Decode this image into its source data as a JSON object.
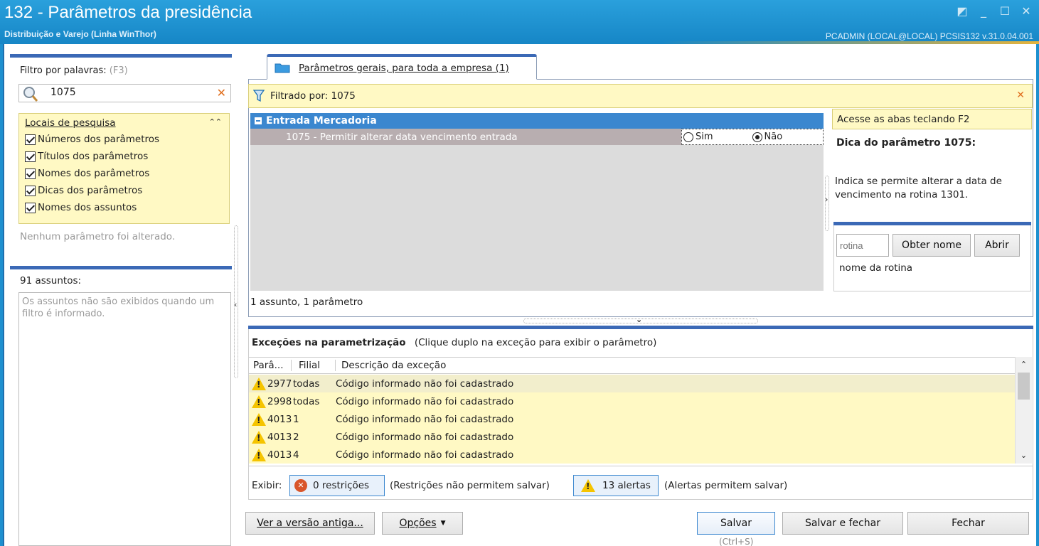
{
  "window": {
    "title": "132 - Parâmetros da presidência",
    "subtitle": "Distribuição e Varejo (Linha WinThor)",
    "user_info": "PCADMIN (LOCAL@LOCAL)   PCSIS132  v.31.0.04.001"
  },
  "left": {
    "filter_label": "Filtro por palavras:",
    "filter_shortcut": "(F3)",
    "filter_value": "1075",
    "locais_title": "Locais de pesquisa",
    "checkboxes": [
      "Números dos parâmetros",
      "Títulos dos parâmetros",
      "Nomes dos parâmetros",
      "Dicas dos parâmetros",
      "Nomes dos assuntos"
    ],
    "no_change_text": "Nenhum parâmetro foi alterado.",
    "assuntos_label": "91 assuntos:",
    "assuntos_info": "Os assuntos não são exibidos quando um filtro é informado."
  },
  "tab": {
    "label": "Parâmetros gerais, para toda a empresa  (1)"
  },
  "filterbar": {
    "text": "Filtrado por: 1075"
  },
  "grid": {
    "group": "Entrada Mercadoria",
    "row_label": "1075 - Permitir alterar data vencimento entrada",
    "opt_yes": "Sim",
    "opt_no": "Não",
    "selected": "Não",
    "status": "1 assunto, 1 parâmetro"
  },
  "right": {
    "hint_bar": "Acesse as abas teclando F2",
    "tip_title": "Dica do parâmetro 1075:",
    "tip_text": "Indica se permite alterar a data de vencimento na rotina 1301.",
    "rotina_placeholder": "rotina",
    "obter_nome": "Obter nome",
    "abrir": "Abrir",
    "nome_rotina": "nome da rotina"
  },
  "exceptions": {
    "title": "Exceções na parametrização",
    "hint": "(Clique duplo na exceção para exibir o parâmetro)",
    "columns": [
      "Parâ...",
      "Filial",
      "Descrição da exceção"
    ],
    "rows": [
      {
        "param": "2977",
        "filial": "todas",
        "desc": "Código informado não foi cadastrado"
      },
      {
        "param": "2998",
        "filial": "todas",
        "desc": "Código informado não foi cadastrado"
      },
      {
        "param": "4013",
        "filial": "1",
        "desc": "Código informado não foi cadastrado"
      },
      {
        "param": "4013",
        "filial": "2",
        "desc": "Código informado não foi cadastrado"
      },
      {
        "param": "4013",
        "filial": "4",
        "desc": "Código informado não foi cadastrado"
      }
    ],
    "exibir_label": "Exibir:",
    "restricoes_btn": "0 restrições",
    "restricoes_note": "(Restrições não permitem salvar)",
    "alertas_btn": "13 alertas",
    "alertas_note": "(Alertas permitem salvar)"
  },
  "footer": {
    "ver_versao": "Ver a versão antiga...",
    "opcoes": "Opções",
    "salvar": "Salvar",
    "salvar_shortcut": "(Ctrl+S)",
    "salvar_fechar": "Salvar e fechar",
    "fechar": "Fechar"
  }
}
